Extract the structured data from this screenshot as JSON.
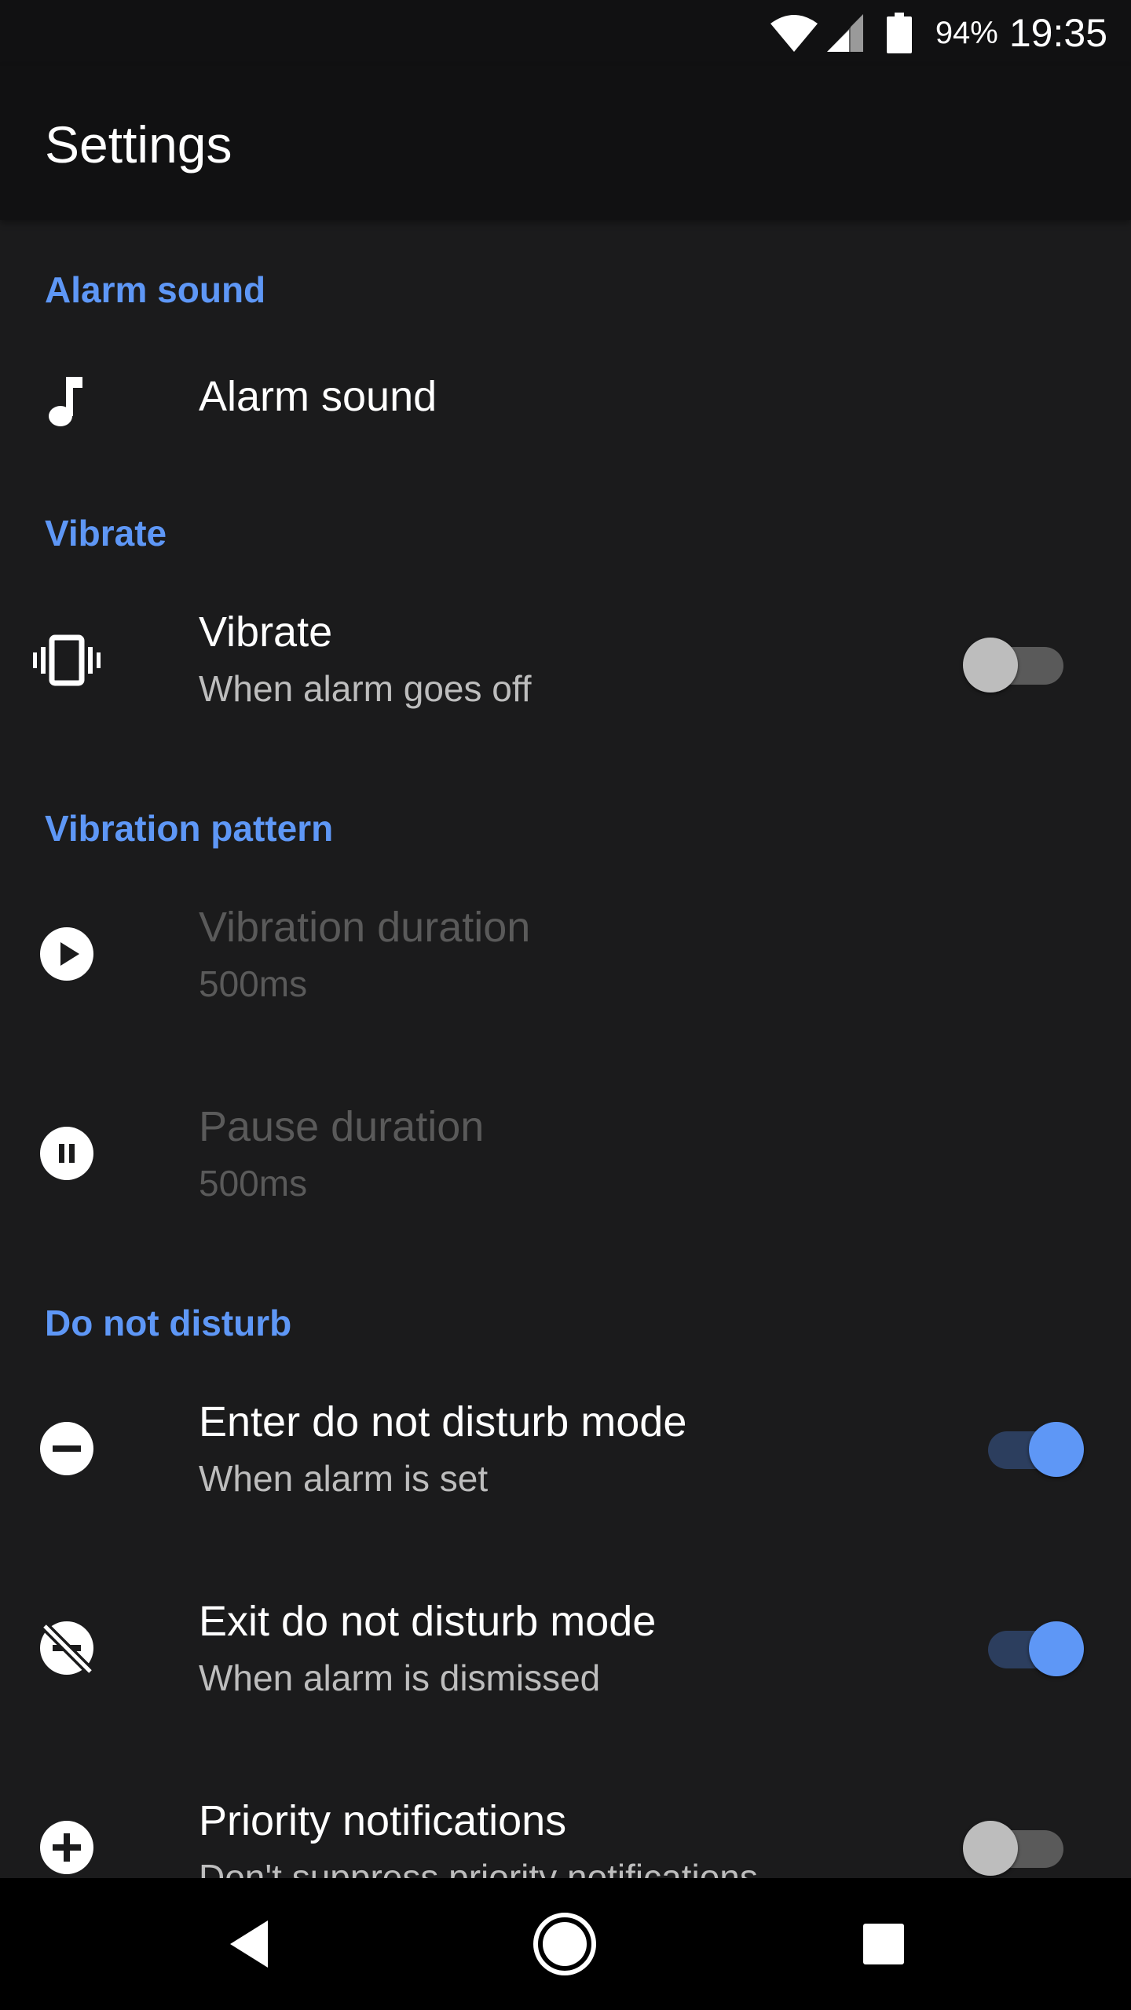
{
  "status_bar": {
    "battery_percent": "94%",
    "time": "19:35",
    "icons": [
      "wifi-icon",
      "cellular-signal-icon",
      "battery-icon"
    ]
  },
  "app_bar": {
    "title": "Settings"
  },
  "sections": {
    "alarm_sound": {
      "header": "Alarm sound",
      "items": {
        "alarm_sound": {
          "title": "Alarm sound",
          "icon": "music-note-icon"
        }
      }
    },
    "vibrate": {
      "header": "Vibrate",
      "items": {
        "vibrate": {
          "title": "Vibrate",
          "summary": "When alarm goes off",
          "icon": "vibration-icon",
          "enabled": false
        }
      }
    },
    "vibration_pattern": {
      "header": "Vibration pattern",
      "items": {
        "vibration_duration": {
          "title": "Vibration duration",
          "summary": "500ms",
          "icon": "play-circle-icon"
        },
        "pause_duration": {
          "title": "Pause duration",
          "summary": "500ms",
          "icon": "pause-circle-icon"
        }
      }
    },
    "do_not_disturb": {
      "header": "Do not disturb",
      "items": {
        "enter_dnd": {
          "title": "Enter do not disturb mode",
          "summary": "When alarm is set",
          "icon": "do-not-disturb-icon",
          "enabled": true
        },
        "exit_dnd": {
          "title": "Exit do not disturb mode",
          "summary": "When alarm is dismissed",
          "icon": "do-not-disturb-off-icon",
          "enabled": true
        },
        "priority": {
          "title": "Priority notifications",
          "summary": "Don't suppress priority notifications",
          "icon": "add-circle-icon",
          "enabled": false
        }
      }
    }
  },
  "colors": {
    "accent": "#5e97f6",
    "background": "#1b1b1c",
    "app_bar": "#111112",
    "nav_bar": "#000000"
  },
  "nav_bar": {
    "icons": [
      "back-icon",
      "home-icon",
      "recents-icon"
    ]
  }
}
